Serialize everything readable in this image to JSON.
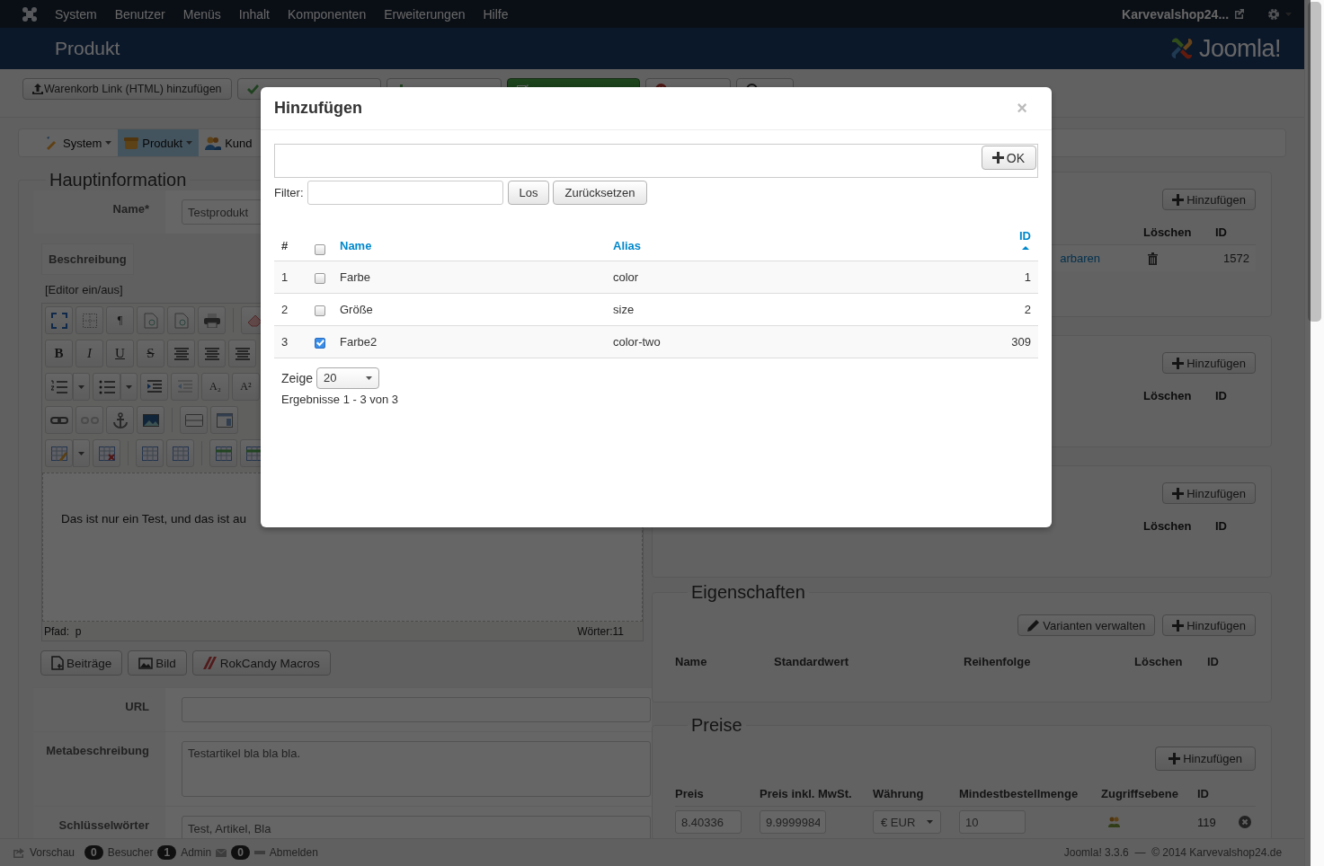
{
  "topbar": {
    "menu": [
      "System",
      "Benutzer",
      "Menüs",
      "Inhalt",
      "Komponenten",
      "Erweiterungen",
      "Hilfe"
    ],
    "site": "Karvevalshop24..."
  },
  "header": {
    "title": "Produkt",
    "logo_text": "Joomla!"
  },
  "toolbar": [
    {
      "kind": "upload",
      "label": "Warenkorb Link (HTML) hinzufügen"
    },
    {
      "kind": "check"
    },
    {
      "kind": "plus"
    },
    {
      "kind": "save"
    },
    {
      "kind": "cancel"
    },
    {
      "kind": "help"
    }
  ],
  "submenu": [
    {
      "label": "System",
      "selected": false
    },
    {
      "label": "Produkt",
      "selected": true
    },
    {
      "label": "Kund",
      "selected": false
    }
  ],
  "main": {
    "legend": "Hauptinformation",
    "name_label": "Name*",
    "name_value": "Testprodukt",
    "desc_tab": "Beschreibung",
    "editor_toggle": "[Editor ein/aus]",
    "editor_toolbar": [
      [
        {
          "kind": "icon"
        },
        {
          "kind": "icon"
        },
        {
          "kind": "glyph",
          "text": "¶"
        },
        {
          "kind": "icon"
        },
        {
          "kind": "icon"
        },
        {
          "kind": "icon"
        },
        {
          "kind": "separator"
        },
        {
          "kind": "icon"
        }
      ],
      [
        {
          "kind": "glyph",
          "text": "B"
        },
        {
          "kind": "glyph",
          "text": "I"
        },
        {
          "kind": "glyph",
          "text": "U"
        },
        {
          "kind": "glyph",
          "text": "S"
        },
        {
          "kind": "icon"
        },
        {
          "kind": "icon"
        },
        {
          "kind": "icon"
        }
      ],
      [
        {
          "kind": "icon"
        },
        {
          "kind": "caret"
        },
        {
          "kind": "icon"
        },
        {
          "kind": "caret"
        },
        {
          "kind": "icon"
        },
        {
          "kind": "icon"
        },
        {
          "kind": "glyph",
          "text": "A₂"
        },
        {
          "kind": "glyph",
          "text": "A²"
        }
      ],
      [
        {
          "kind": "icon"
        },
        {
          "kind": "icon"
        },
        {
          "kind": "icon"
        },
        {
          "kind": "icon"
        },
        {
          "kind": "separator"
        },
        {
          "kind": "icon"
        },
        {
          "kind": "icon"
        }
      ],
      [
        {
          "kind": "icon"
        },
        {
          "kind": "caret"
        },
        {
          "kind": "icon"
        },
        {
          "kind": "separator"
        },
        {
          "kind": "icon"
        },
        {
          "kind": "icon"
        },
        {
          "kind": "separator"
        },
        {
          "kind": "icon"
        },
        {
          "kind": "icon"
        }
      ]
    ],
    "editor_text": "Das ist nur ein Test, und das ist au",
    "path": "Pfad:  p",
    "words": "Wörter:11",
    "editor_buttons": [
      "Beiträge",
      "Bild",
      "RokCandy Macros"
    ],
    "fields": [
      {
        "label": "URL",
        "kind": "input"
      },
      {
        "label": "Metabeschreibung",
        "value": "Testartikel bla bla bla.",
        "kind": "textarea"
      },
      {
        "label": "Schlüsselwörter",
        "value": "Test, Artikel, Bla",
        "kind": "input"
      }
    ]
  },
  "panels": [
    {
      "button": "Hinzufügen",
      "columns": [
        "Löschen",
        "ID"
      ],
      "rows": [
        {
          "link": "arbaren",
          "id": "1572"
        }
      ]
    },
    {
      "button": "Hinzufügen",
      "columns": [
        "Löschen",
        "ID"
      ]
    },
    {
      "button": "Hinzufügen",
      "columns": [
        "Löschen",
        "ID"
      ]
    }
  ],
  "properties": {
    "legend": "Eigenschaften",
    "buttons": [
      "Varianten verwalten",
      "Hinzufügen"
    ],
    "columns": [
      "Name",
      "Standardwert",
      "Reihenfolge",
      "Löschen",
      "ID"
    ]
  },
  "prices": {
    "legend": "Preise",
    "button": "Hinzufügen",
    "columns": [
      "Preis",
      "Preis inkl. MwSt.",
      "Währung",
      "Mindestbestellmenge",
      "Zugriffsebene",
      "ID"
    ],
    "row": {
      "price": "8.40336",
      "price_gross": "9.9999984",
      "currency": "€ EUR",
      "min_qty": "10",
      "id": "119"
    }
  },
  "status_bar": {
    "preview": "Vorschau",
    "visitors_count": "0",
    "visitors": "Besucher",
    "admins_count": "1",
    "admins": "Admin",
    "messages_count": "0",
    "logout": "Abmelden",
    "version": "Joomla! 3.3.6  —  © 2014 Karvevalshop24.de"
  },
  "modal": {
    "title": "Hinzufügen",
    "close": "×",
    "ok": "OK",
    "filter_label": "Filter:",
    "search": "Los",
    "reset": "Zurücksetzen",
    "select_all": false,
    "columns": [
      "#",
      "Name",
      "Alias",
      "ID"
    ],
    "rows": [
      {
        "num": "1",
        "checked": false,
        "name": "Farbe",
        "alias": "color",
        "id": "1"
      },
      {
        "num": "2",
        "checked": false,
        "name": "Größe",
        "alias": "size",
        "id": "2"
      },
      {
        "num": "3",
        "checked": true,
        "name": "Farbe2",
        "alias": "color-two",
        "id": "309"
      }
    ],
    "show_label": "Zeige",
    "page_size": "20",
    "results": "Ergebnisse 1 - 3 von 3"
  }
}
